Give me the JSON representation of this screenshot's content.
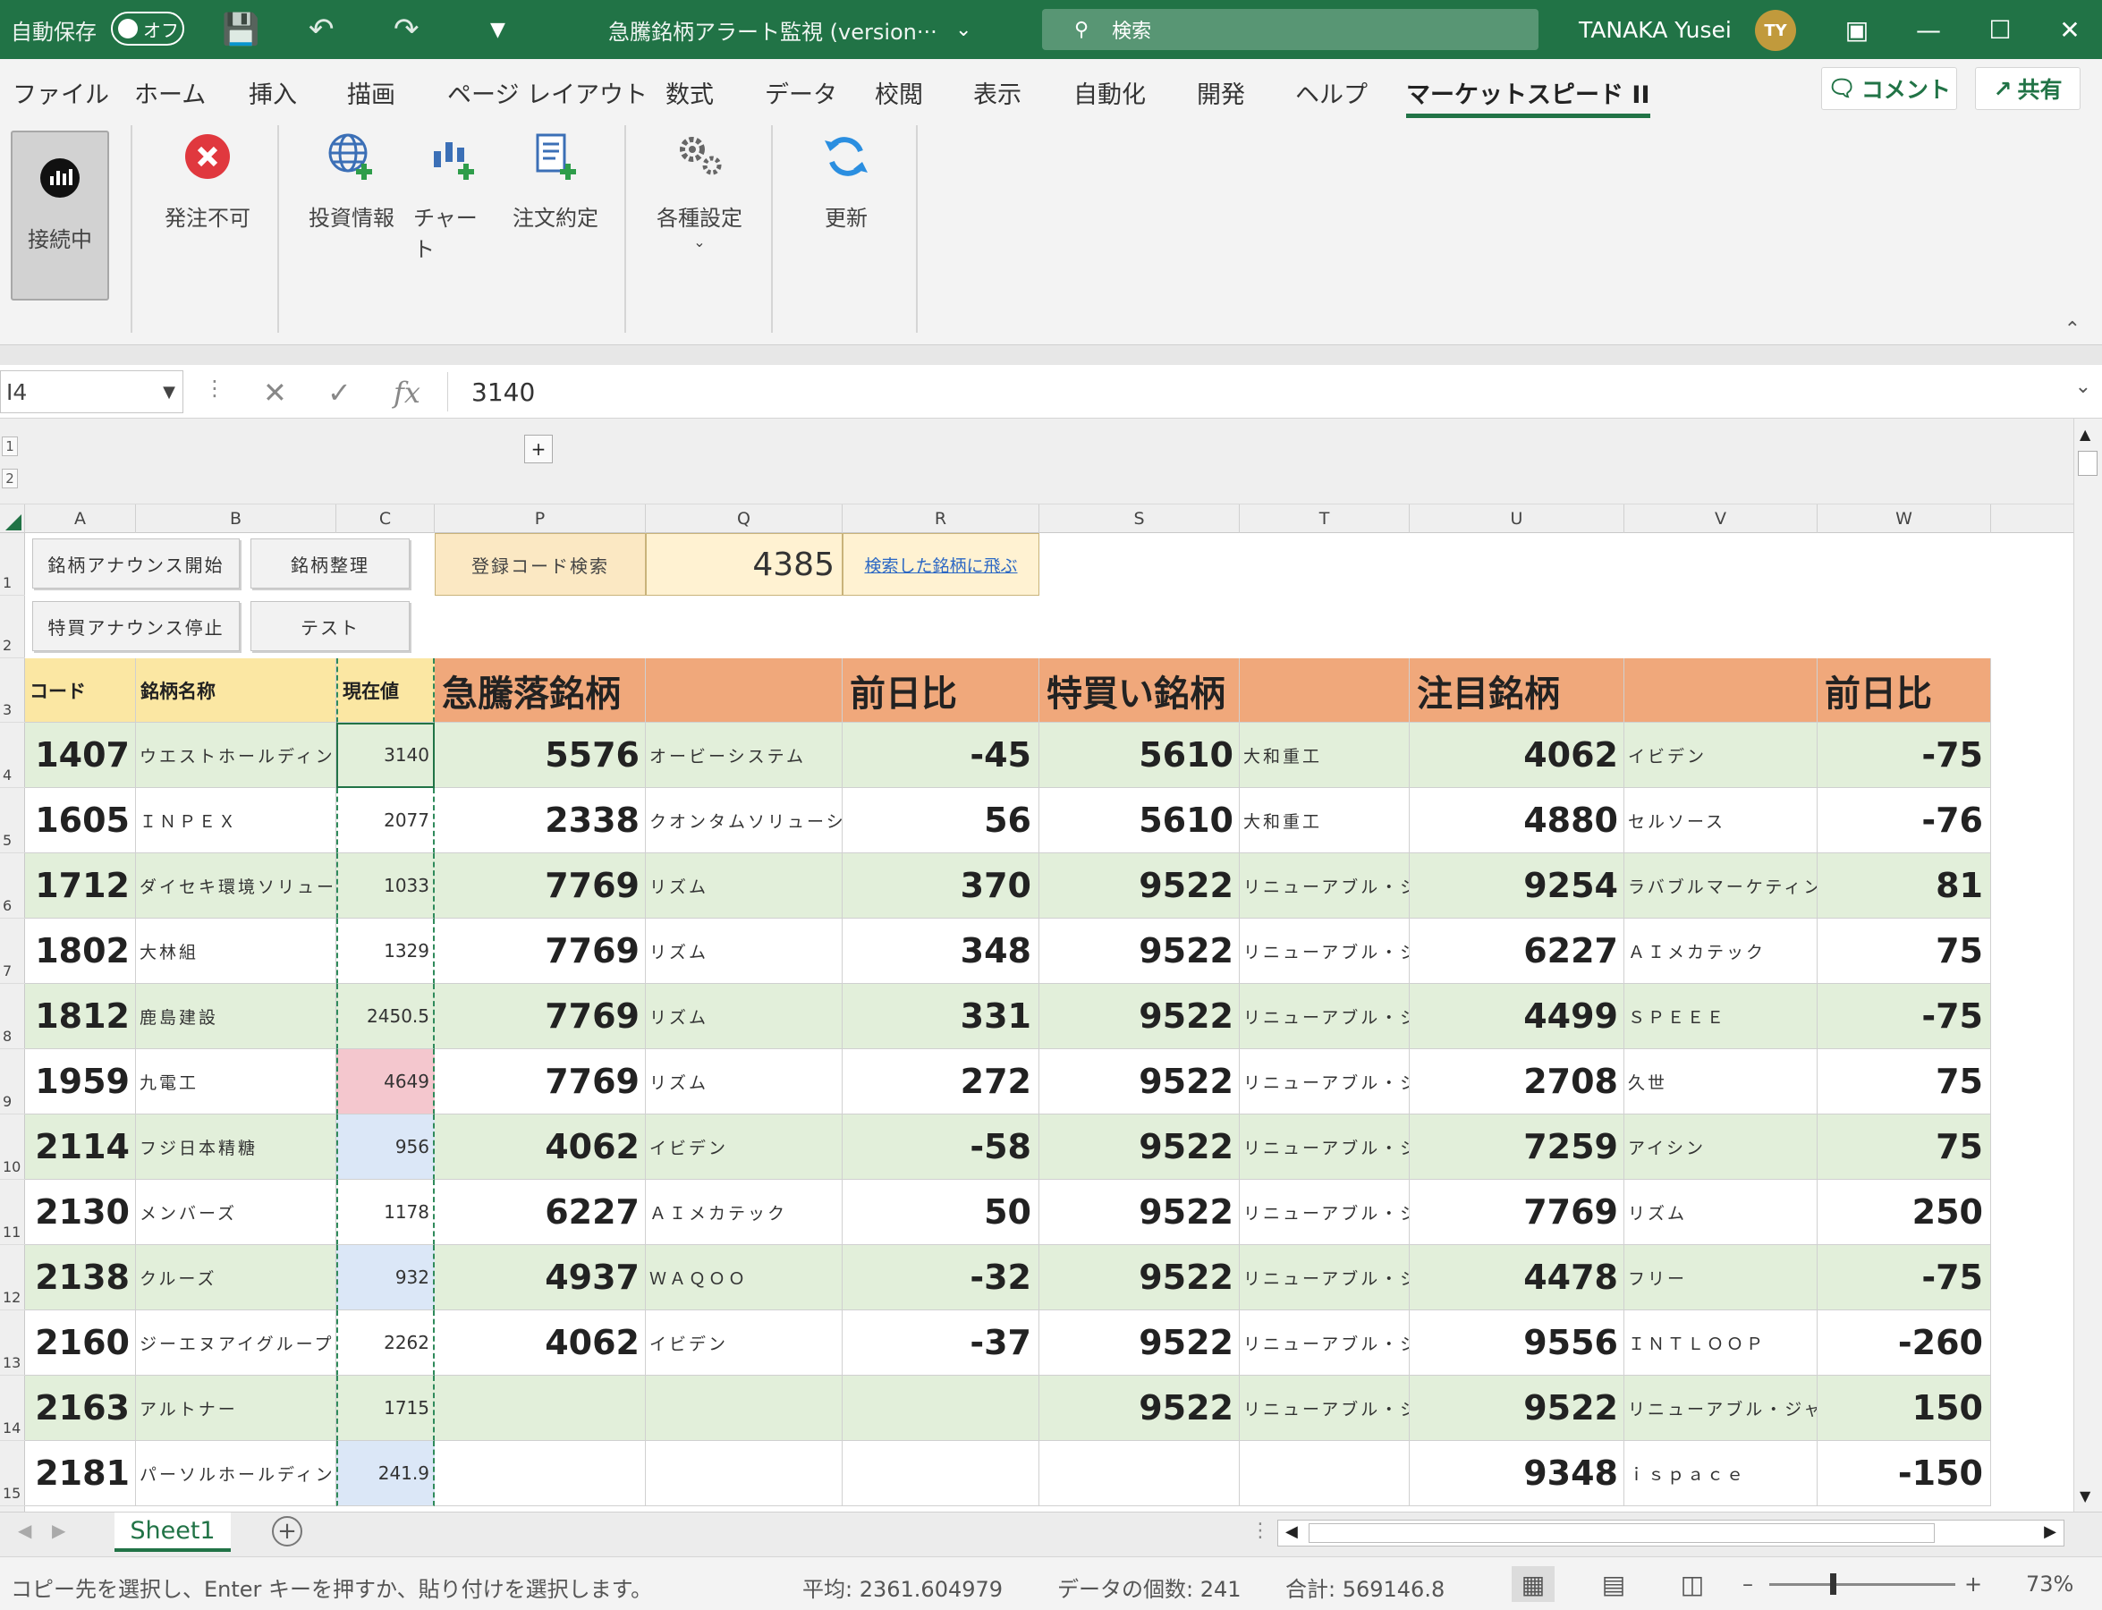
{
  "titlebar": {
    "autosave_label": "自動保存",
    "autosave_state": "オフ",
    "doc_title": "急騰銘柄アラート監視 (version···",
    "search_placeholder": "検索",
    "user_name": "TANAKA Yusei",
    "user_initials": "TY"
  },
  "menu": [
    "ファイル",
    "ホーム",
    "挿入",
    "描画",
    "ページ レイアウト",
    "数式",
    "データ",
    "校閲",
    "表示",
    "自動化",
    "開発",
    "ヘルプ",
    "マーケットスピード II"
  ],
  "menu_active": "マーケットスピード II",
  "top_buttons": {
    "comment": "コメント",
    "share": "共有"
  },
  "ribbon": {
    "connect": "接続中",
    "no_order": "発注不可",
    "invest_info": "投資情報",
    "chart": "チャート",
    "order_fill": "注文約定",
    "settings": "各種設定",
    "refresh": "更新"
  },
  "formula": {
    "name_box": "I4",
    "value": "3140"
  },
  "outline_levels": [
    "1",
    "2"
  ],
  "columns": [
    "A",
    "B",
    "C",
    "P",
    "Q",
    "R",
    "S",
    "T",
    "U",
    "V",
    "W"
  ],
  "rows": [
    "1",
    "2",
    "3",
    "4",
    "5",
    "6",
    "7",
    "8",
    "9",
    "10",
    "11",
    "12",
    "13",
    "14",
    "15"
  ],
  "controls": {
    "btn_announce_start": "銘柄アナウンス開始",
    "btn_organize": "銘柄整理",
    "btn_announce_stop": "特買アナウンス停止",
    "btn_test": "テスト",
    "search_label": "登録コード検索",
    "search_value": "4385",
    "jump_link": "検索した銘柄に飛ぶ"
  },
  "headers": {
    "code": "コード",
    "name": "銘柄名称",
    "price": "現在値",
    "surge": "急騰落銘柄",
    "diff1": "前日比",
    "special_buy": "特買い銘柄",
    "watch": "注目銘柄",
    "diff2": "前日比"
  },
  "table": [
    {
      "code": "1407",
      "name": "ウエストホールディン",
      "price": "3140",
      "p": "5576",
      "q": "オービーシステム",
      "r": "-45",
      "s": "5610",
      "t": "大和重工",
      "u": "4062",
      "v": "イビデン",
      "w": "-75"
    },
    {
      "code": "1605",
      "name": "ＩＮＰＥＸ",
      "price": "2077",
      "p": "2338",
      "q": "クオンタムソリューシ",
      "r": "56",
      "s": "5610",
      "t": "大和重工",
      "u": "4880",
      "v": "セルソース",
      "w": "-76"
    },
    {
      "code": "1712",
      "name": "ダイセキ環境ソリュー",
      "price": "1033",
      "p": "7769",
      "q": "リズム",
      "r": "370",
      "s": "9522",
      "t": "リニューアブル・ジ",
      "u": "9254",
      "v": "ラバブルマーケティン",
      "w": "81"
    },
    {
      "code": "1802",
      "name": "大林組",
      "price": "1329",
      "p": "7769",
      "q": "リズム",
      "r": "348",
      "s": "9522",
      "t": "リニューアブル・ジ",
      "u": "6227",
      "v": "ＡＩメカテック",
      "w": "75"
    },
    {
      "code": "1812",
      "name": "鹿島建設",
      "price": "2450.5",
      "p": "7769",
      "q": "リズム",
      "r": "331",
      "s": "9522",
      "t": "リニューアブル・ジ",
      "u": "4499",
      "v": "ＳＰＥＥＥ",
      "w": "-75"
    },
    {
      "code": "1959",
      "name": "九電工",
      "price": "4649",
      "p": "7769",
      "q": "リズム",
      "r": "272",
      "s": "9522",
      "t": "リニューアブル・ジ",
      "u": "2708",
      "v": "久世",
      "w": "75"
    },
    {
      "code": "2114",
      "name": "フジ日本精糖",
      "price": "956",
      "p": "4062",
      "q": "イビデン",
      "r": "-58",
      "s": "9522",
      "t": "リニューアブル・ジ",
      "u": "7259",
      "v": "アイシン",
      "w": "75"
    },
    {
      "code": "2130",
      "name": "メンバーズ",
      "price": "1178",
      "p": "6227",
      "q": "ＡＩメカテック",
      "r": "50",
      "s": "9522",
      "t": "リニューアブル・ジ",
      "u": "7769",
      "v": "リズム",
      "w": "250"
    },
    {
      "code": "2138",
      "name": "クルーズ",
      "price": "932",
      "p": "4937",
      "q": "ＷＡＱＯＯ",
      "r": "-32",
      "s": "9522",
      "t": "リニューアブル・ジ",
      "u": "4478",
      "v": "フリー",
      "w": "-75"
    },
    {
      "code": "2160",
      "name": "ジーエヌアイグループ",
      "price": "2262",
      "p": "4062",
      "q": "イビデン",
      "r": "-37",
      "s": "9522",
      "t": "リニューアブル・ジ",
      "u": "9556",
      "v": "ＩＮＴＬＯＯＰ",
      "w": "-260"
    },
    {
      "code": "2163",
      "name": "アルトナー",
      "price": "1715",
      "p": "",
      "q": "",
      "r": "",
      "s": "9522",
      "t": "リニューアブル・ジ",
      "u": "9522",
      "v": "リニューアブル・ジャ",
      "w": "150"
    },
    {
      "code": "2181",
      "name": "パーソルホールディン",
      "price": "241.9",
      "p": "",
      "q": "",
      "r": "",
      "s": "",
      "t": "",
      "u": "9348",
      "v": "ｉｓｐａｃｅ",
      "w": "-150"
    }
  ],
  "price_highlights": {
    "4649": "#f4c7ce",
    "956": "#dbe7f7",
    "932": "#dbe7f7",
    "241.9": "#dbe7f7"
  },
  "colors": {
    "accent": "#217346",
    "row_green": "#e2efda",
    "header_yellow": "#fbe7a3",
    "header_orange": "#f0a87b"
  },
  "sheet_tab": "Sheet1",
  "status": {
    "message": "コピー先を選択し、Enter キーを押すか、貼り付けを選択します。",
    "average": "平均: 2361.604979",
    "count": "データの個数: 241",
    "sum": "合計: 569146.8",
    "zoom": "73%"
  }
}
